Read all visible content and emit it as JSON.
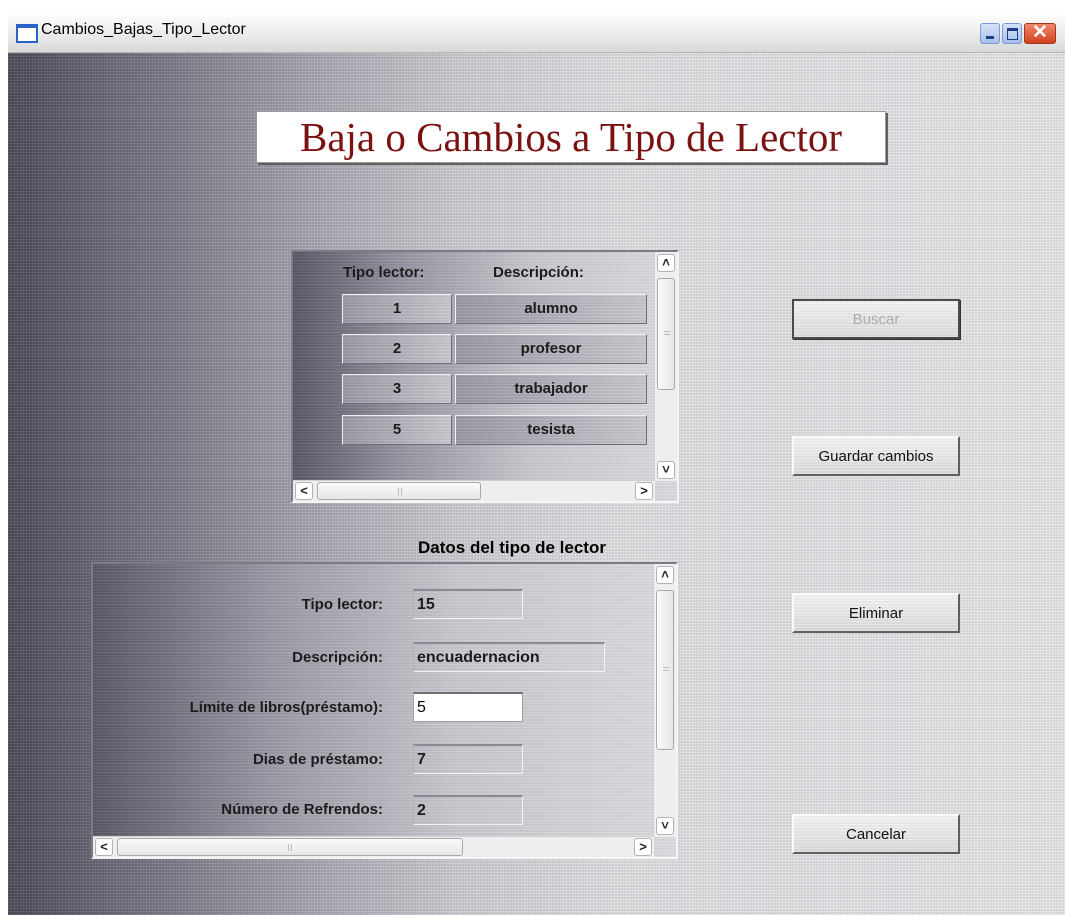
{
  "window": {
    "title": "Cambios_Bajas_Tipo_Lector",
    "controls": {
      "minimize": "_",
      "maximize": "□",
      "close": "✕"
    }
  },
  "heading": "Baja o Cambios a Tipo de Lector",
  "grid": {
    "columns": [
      "Tipo lector:",
      "Descripción:"
    ],
    "rows": [
      {
        "id": "1",
        "desc": "alumno"
      },
      {
        "id": "2",
        "desc": "profesor"
      },
      {
        "id": "3",
        "desc": "trabajador"
      },
      {
        "id": "5",
        "desc": "tesista"
      }
    ]
  },
  "details": {
    "caption": "Datos del tipo de lector",
    "fields": [
      {
        "label": "Tipo lector:",
        "value": "15"
      },
      {
        "label": "Descripción:",
        "value": "encuadernacion"
      },
      {
        "label": "Límite de libros(préstamo):",
        "value": "5"
      },
      {
        "label": "Dias de préstamo:",
        "value": "7"
      },
      {
        "label": "Número de Refrendos:",
        "value": "2"
      }
    ]
  },
  "buttons": {
    "search": "Buscar",
    "save": "Guardar cambios",
    "delete": "Eliminar",
    "cancel": "Cancelar"
  },
  "scroll_glyphs": {
    "up": "˄",
    "down": "˅",
    "left": "<",
    "right": ">"
  }
}
